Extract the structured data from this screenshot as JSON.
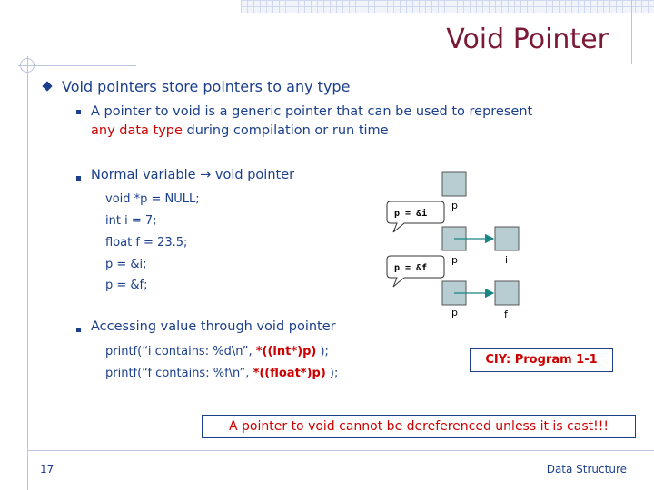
{
  "slide": {
    "title": "Void Pointer",
    "bullet1": "Void pointers store pointers to any type",
    "sub1_part1": "A pointer to void is a generic pointer that can be used to represent",
    "sub1_red": "any data type",
    "sub1_part2": " during compilation or run time",
    "sub2": "Normal variable → void pointer",
    "code_decl": [
      "void *p = NULL;",
      "int i = 7;",
      "float f = 23.5;",
      "p = &i;",
      "p = &f;"
    ],
    "sub3": "Accessing value through void pointer",
    "code_access_1_pre": "printf(“i contains: %d\\n”, ",
    "code_access_1_bold": "*((int*)p)",
    "code_access_1_post": " );",
    "code_access_2_pre": "printf(“f contains: %f\\n”, ",
    "code_access_2_bold": "*((float*)p)",
    "code_access_2_post": " );",
    "ciy": "CIY: Program 1-1",
    "note": "A pointer to void cannot be dereferenced unless it is cast!!!",
    "page_number": "17",
    "footer": "Data Structure"
  },
  "diagram": {
    "callout1": "p = &i",
    "callout2": "p = &f",
    "label_p": "p",
    "label_i": "i",
    "label_f": "f"
  },
  "colors": {
    "title": "#7a1a35",
    "text": "#1b3f8b",
    "highlight": "#cc0000",
    "box_fill": "#b8cdd2",
    "arrow": "#1a8585"
  },
  "icons": {
    "bullet_level1": "diamond-bullet-icon",
    "bullet_level2": "square-bullet-icon"
  }
}
